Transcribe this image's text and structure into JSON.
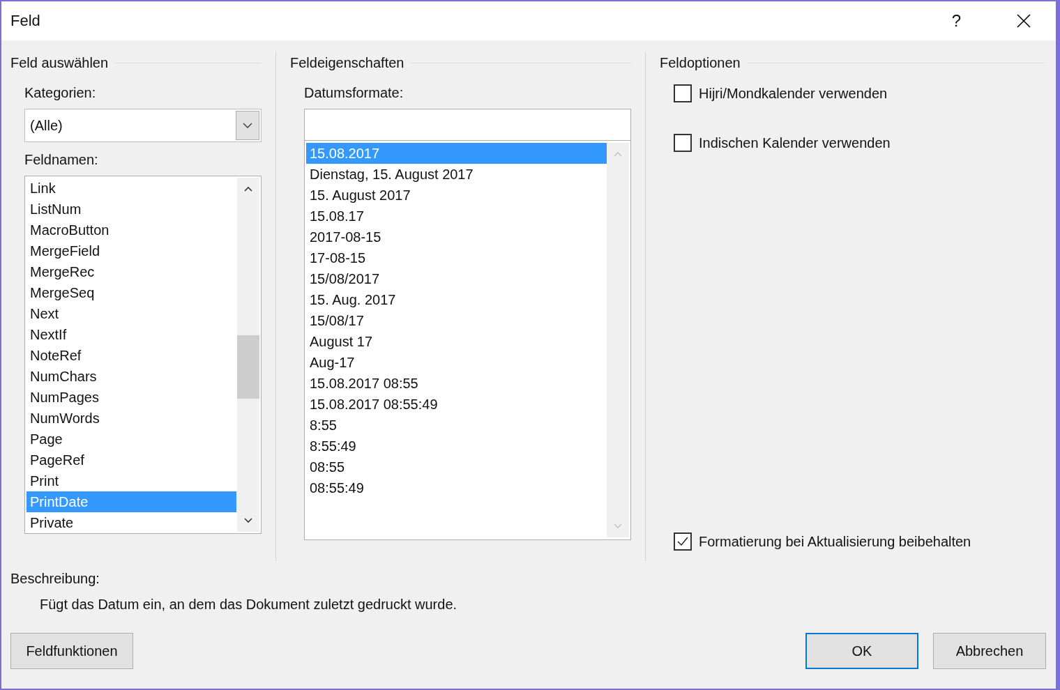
{
  "window": {
    "title": "Feld",
    "help": "?"
  },
  "select_field": {
    "heading": "Feld auswählen",
    "categories_label": "Kategorien:",
    "category_value": "(Alle)",
    "field_names_label": "Feldnamen:",
    "field_names": [
      {
        "label": "Link",
        "selected": false
      },
      {
        "label": "ListNum",
        "selected": false
      },
      {
        "label": "MacroButton",
        "selected": false
      },
      {
        "label": "MergeField",
        "selected": false
      },
      {
        "label": "MergeRec",
        "selected": false
      },
      {
        "label": "MergeSeq",
        "selected": false
      },
      {
        "label": "Next",
        "selected": false
      },
      {
        "label": "NextIf",
        "selected": false
      },
      {
        "label": "NoteRef",
        "selected": false
      },
      {
        "label": "NumChars",
        "selected": false
      },
      {
        "label": "NumPages",
        "selected": false
      },
      {
        "label": "NumWords",
        "selected": false
      },
      {
        "label": "Page",
        "selected": false
      },
      {
        "label": "PageRef",
        "selected": false
      },
      {
        "label": "Print",
        "selected": false
      },
      {
        "label": "PrintDate",
        "selected": true
      },
      {
        "label": "Private",
        "selected": false
      }
    ]
  },
  "field_properties": {
    "heading": "Feldeigenschaften",
    "date_formats_label": "Datumsformate:",
    "date_formats": [
      {
        "label": "15.08.2017",
        "selected": true
      },
      {
        "label": "Dienstag, 15. August 2017",
        "selected": false
      },
      {
        "label": "15. August 2017",
        "selected": false
      },
      {
        "label": "15.08.17",
        "selected": false
      },
      {
        "label": "2017-08-15",
        "selected": false
      },
      {
        "label": "17-08-15",
        "selected": false
      },
      {
        "label": "15/08/2017",
        "selected": false
      },
      {
        "label": "15. Aug. 2017",
        "selected": false
      },
      {
        "label": "15/08/17",
        "selected": false
      },
      {
        "label": "August 17",
        "selected": false
      },
      {
        "label": "Aug-17",
        "selected": false
      },
      {
        "label": "15.08.2017 08:55",
        "selected": false
      },
      {
        "label": "15.08.2017 08:55:49",
        "selected": false
      },
      {
        "label": "8:55",
        "selected": false
      },
      {
        "label": "8:55:49",
        "selected": false
      },
      {
        "label": "08:55",
        "selected": false
      },
      {
        "label": "08:55:49",
        "selected": false
      }
    ]
  },
  "field_options": {
    "heading": "Feldoptionen",
    "options": [
      {
        "label": "Hijri/Mondkalender verwenden",
        "checked": false
      },
      {
        "label": "Indischen Kalender verwenden",
        "checked": false
      }
    ],
    "preserve_formatting": {
      "label": "Formatierung bei Aktualisierung beibehalten",
      "checked": true
    }
  },
  "description": {
    "label": "Beschreibung:",
    "text": "Fügt das Datum ein, an dem das Dokument zuletzt gedruckt wurde."
  },
  "buttons": {
    "field_codes": {
      "label": "Feldfunktionen",
      "focused": false
    },
    "ok": {
      "label": "OK",
      "focused": true
    },
    "cancel": {
      "label": "Abbrechen",
      "focused": false
    }
  }
}
